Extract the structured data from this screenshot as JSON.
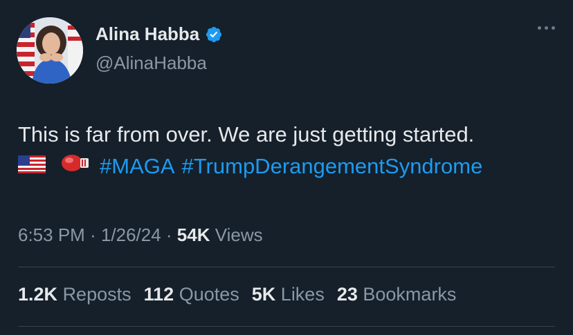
{
  "author": {
    "name": "Alina Habba",
    "handle": "@AlinaHabba",
    "verified_color": "#1d9bf0"
  },
  "tweet": {
    "line1": "This is far from over. We are just getting started.",
    "emojis": [
      "us-flag-emoji",
      "boxing-glove-emoji"
    ],
    "hashtags": [
      "#MAGA",
      "#TrumpDerangementSyndrome"
    ]
  },
  "meta": {
    "time": "6:53 PM",
    "sep1": " · ",
    "date": "1/26/24",
    "sep2": " · ",
    "views_count": "54K",
    "views_label": "Views"
  },
  "stats": {
    "reposts_count": "1.2K",
    "reposts_label": "Reposts",
    "quotes_count": "112",
    "quotes_label": "Quotes",
    "likes_count": "5K",
    "likes_label": "Likes",
    "bookmarks_count": "23",
    "bookmarks_label": "Bookmarks"
  },
  "colors": {
    "background": "#15202b",
    "text": "#e7e9ea",
    "secondary": "#8b98a5",
    "link": "#1d9bf0"
  }
}
